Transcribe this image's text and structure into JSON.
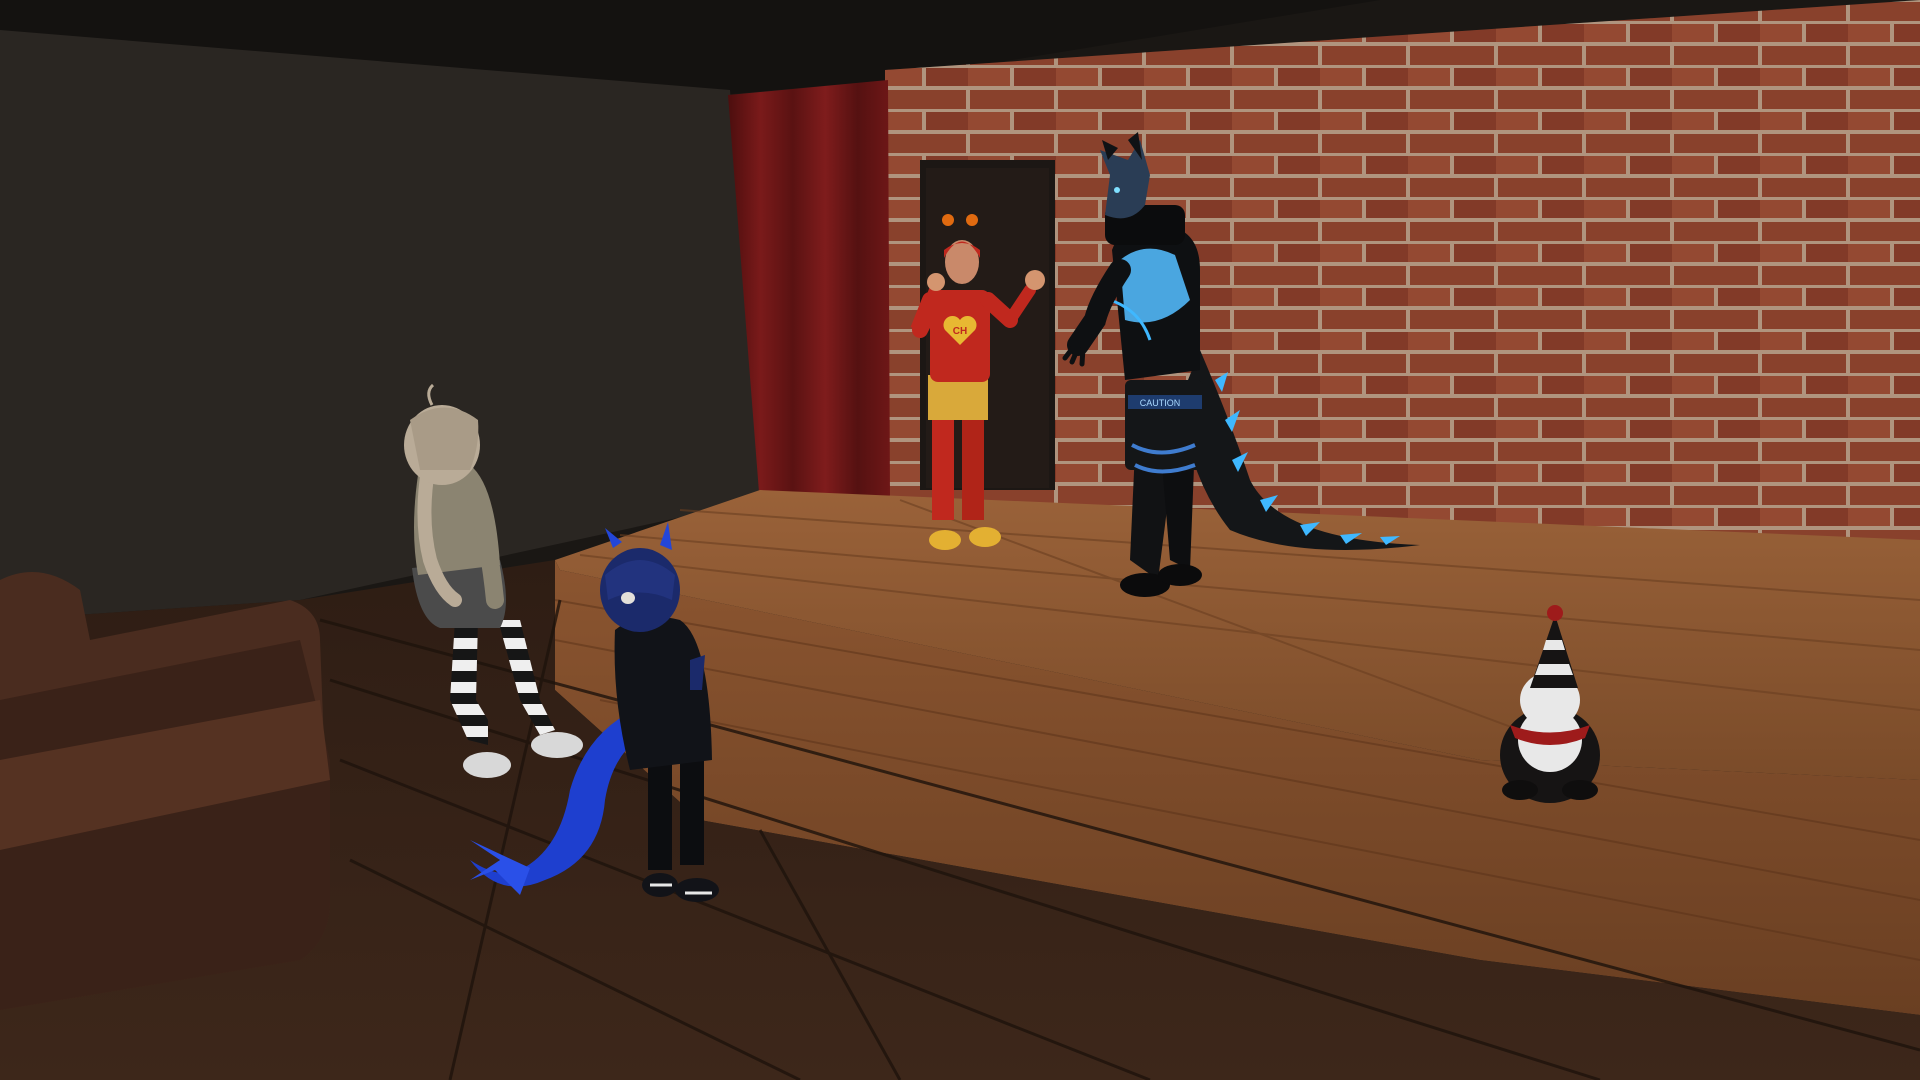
{
  "scene": {
    "colors": {
      "ceiling": "#1a1816",
      "left_wall": "#2a2622",
      "brick": "#9c4a33",
      "mortar": "#c9a990",
      "stage_wood": "#8a5631",
      "floor_wood": "#3a2418",
      "curtain": "#6e1717",
      "door": "#1c1714",
      "sofa": "#4a2c1f"
    },
    "characters": {
      "red_hero": {
        "chest_text": "CH",
        "colors": {
          "suit": "#c0281e",
          "shorts": "#d9a93a",
          "antenna": "#e06a10"
        }
      },
      "armored_wolf": {
        "belt_text": "CAUTION",
        "colors": {
          "armor": "#141618",
          "glow": "#3fb8ff",
          "shirt": "#4aa6e0"
        }
      },
      "girl_striped": {
        "colors": {
          "hair": "#b9ab97",
          "sweater": "#8b8471",
          "skirt": "#4b4b4b"
        }
      },
      "dragon_kid": {
        "colors": {
          "hoodie": "#111318",
          "tail": "#1e3fcf",
          "hair": "#1b2a6b"
        }
      },
      "penguin_plush": {
        "colors": {
          "body": "#161414",
          "belly": "#e8e8e8",
          "scarf": "#9e1b1b"
        }
      }
    }
  }
}
